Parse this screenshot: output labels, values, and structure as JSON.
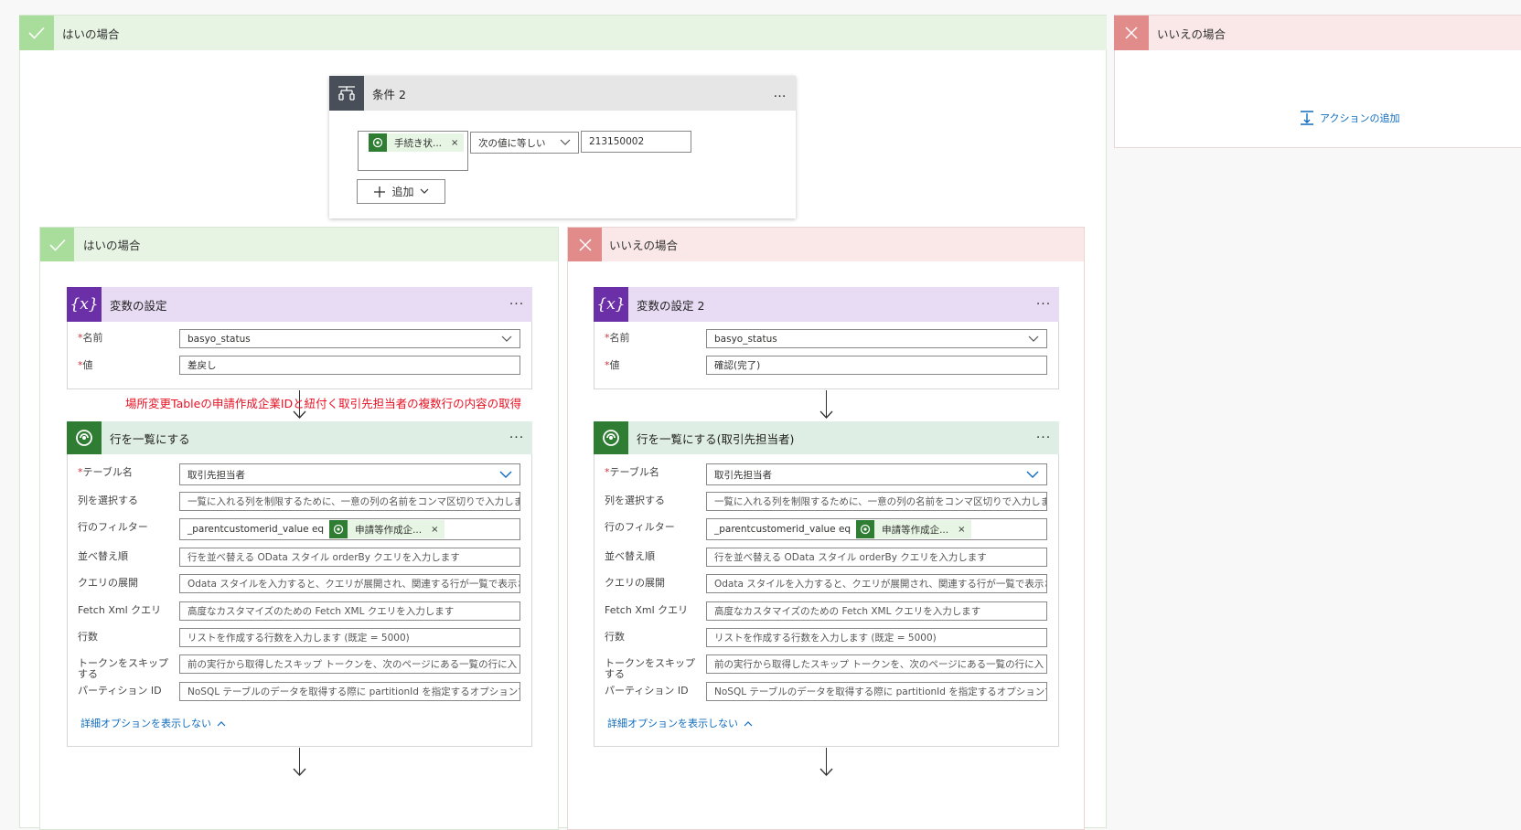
{
  "outer_yes": {
    "title": "はいの場合"
  },
  "outer_no": {
    "title": "いいえの場合",
    "add_action": "アクションの追加"
  },
  "condition": {
    "title": "条件 2",
    "menu": "…",
    "token_label": "手続き状...",
    "token_close": "×",
    "operator": "次の値に等しい",
    "value": "213150002",
    "add_label": "追加"
  },
  "inner_yes": {
    "title": "はいの場合",
    "var_card": {
      "title": "変数の設定",
      "menu": "···",
      "name_label": "名前",
      "name_value": "basyo_status",
      "value_label": "値",
      "value_value": "差戻し"
    },
    "annotation": "場所変更Tableの申請作成企業IDと紐付く取引先担当者の複数行の内容の取得",
    "list_card": {
      "title": "行を一覧にする",
      "menu": "···",
      "fields": [
        {
          "label": "テーブル名",
          "required": "*",
          "value": "取引先担当者"
        },
        {
          "label": "列を選択する",
          "value": "一覧に入れる列を制限するために、一意の列の名前をコンマ区切りで入力しま"
        },
        {
          "label": "行のフィルター",
          "value": "_parentcustomerid_value eq",
          "token": "申請等作成企...",
          "token_close": "×"
        },
        {
          "label": "並べ替え順",
          "value": "行を並べ替える OData スタイル orderBy クエリを入力します"
        },
        {
          "label": "クエリの展開",
          "value": "Odata スタイルを入力すると、クエリが展開され、関連する行が一覧で表示さ"
        },
        {
          "label": "Fetch Xml クエリ",
          "value": "高度なカスタマイズのための Fetch XML クエリを入力します"
        },
        {
          "label": "行数",
          "value": "リストを作成する行数を入力します (既定 = 5000)"
        },
        {
          "label": "トークンをスキップする",
          "value": "前の実行から取得したスキップ トークンを、次のページにある一覧の行に入"
        },
        {
          "label": "パーティション ID",
          "value": "NoSQL テーブルのデータを取得する際に partitionId を指定するオプションで"
        }
      ],
      "hide_advanced": "詳細オプションを表示しない"
    }
  },
  "inner_no": {
    "title": "いいえの場合",
    "var_card": {
      "title": "変数の設定 2",
      "menu": "···",
      "name_label": "名前",
      "name_value": "basyo_status",
      "value_label": "値",
      "value_value": "確認(完了)"
    },
    "list_card": {
      "title": "行を一覧にする(取引先担当者)",
      "menu": "···",
      "fields": [
        {
          "label": "テーブル名",
          "required": "*",
          "value": "取引先担当者"
        },
        {
          "label": "列を選択する",
          "value": "一覧に入れる列を制限するために、一意の列の名前をコンマ区切りで入力しま"
        },
        {
          "label": "行のフィルター",
          "value": "_parentcustomerid_value eq",
          "token": "申請等作成企...",
          "token_close": "×"
        },
        {
          "label": "並べ替え順",
          "value": "行を並べ替える OData スタイル orderBy クエリを入力します"
        },
        {
          "label": "クエリの展開",
          "value": "Odata スタイルを入力すると、クエリが展開され、関連する行が一覧で表示さ"
        },
        {
          "label": "Fetch Xml クエリ",
          "value": "高度なカスタマイズのための Fetch XML クエリを入力します"
        },
        {
          "label": "行数",
          "value": "リストを作成する行数を入力します (既定 = 5000)"
        },
        {
          "label": "トークンをスキップする",
          "value": "前の実行から取得したスキップ トークンを、次のページにある一覧の行に入"
        },
        {
          "label": "パーティション ID",
          "value": "NoSQL テーブルのデータを取得する際に partitionId を指定するオプションで"
        }
      ],
      "hide_advanced": "詳細オプションを表示しない"
    }
  },
  "colors": {
    "yes_bg": "#e7f4e4",
    "yes_accent": "#a9dd9b",
    "no_bg": "#f9e8e7",
    "no_accent": "#e28b8b",
    "var_header": "#e8dcf5",
    "var_icon": "#6b2fa8",
    "dv_header": "#deeee4",
    "dv_icon": "#2e7d32",
    "annotation": "#e81123"
  }
}
